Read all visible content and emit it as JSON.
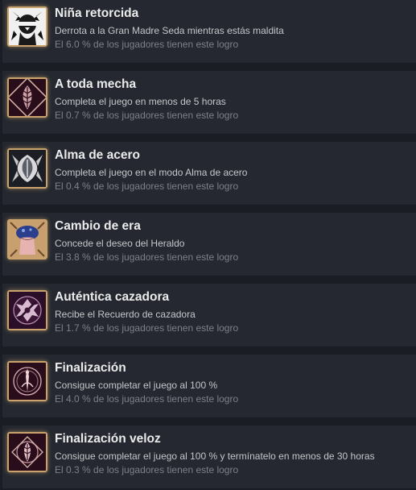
{
  "achievements": [
    {
      "title": "Niña retorcida",
      "description": "Derrota a la Gran Madre Seda mientras estás maldita",
      "percent_text": "El 6.0 % de los jugadores tienen este logro",
      "icon": "cursed-girl-icon"
    },
    {
      "title": "A toda mecha",
      "description": "Completa el juego en menos de 5 horas",
      "percent_text": "El 0.7 % de los jugadores tienen este logro",
      "icon": "speed-leaf-crest-icon"
    },
    {
      "title": "Alma de acero",
      "description": "Completa el juego en el modo Alma de acero",
      "percent_text": "El 0.4 % de los jugadores tienen este logro",
      "icon": "steel-soul-crest-icon"
    },
    {
      "title": "Cambio de era",
      "description": "Concede el deseo del Heraldo",
      "percent_text": "El 3.8 % de los jugadores tienen este logro",
      "icon": "herald-mushroom-icon"
    },
    {
      "title": "Auténtica cazadora",
      "description": "Recibe el Recuerdo de cazadora",
      "percent_text": "El 1.7 % de los jugadores tienen este logro",
      "icon": "huntress-crest-icon"
    },
    {
      "title": "Finalización",
      "description": "Consigue completar el juego al 100 %",
      "percent_text": "El 4.0 % de los jugadores tienen este logro",
      "icon": "completion-crest-icon"
    },
    {
      "title": "Finalización veloz",
      "description": "Consigue completar el juego al 100 % y termínatelo en menos de 30 horas",
      "percent_text": "El 0.3 % de los jugadores tienen este logro",
      "icon": "speed-completion-crest-icon"
    }
  ]
}
